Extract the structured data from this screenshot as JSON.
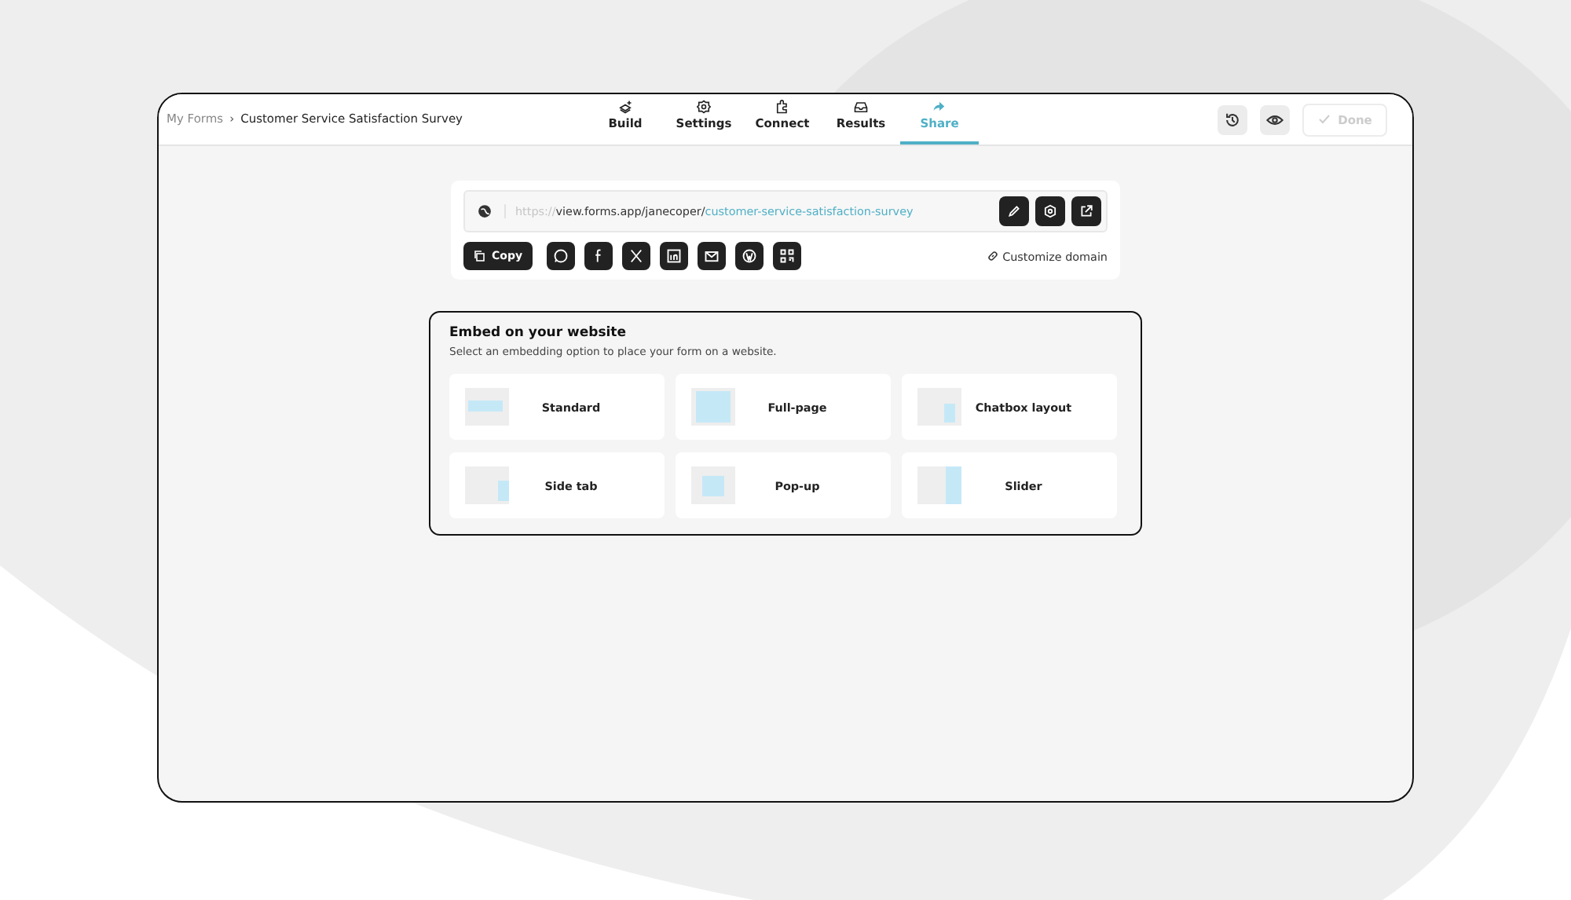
{
  "breadcrumb": {
    "parent": "My Forms",
    "separator": "›",
    "current": "Customer Service Satisfaction Survey"
  },
  "tabs": [
    {
      "label": "Build",
      "kind": "build",
      "selected": false
    },
    {
      "label": "Settings",
      "kind": "settings",
      "selected": false
    },
    {
      "label": "Connect",
      "kind": "connect",
      "selected": false
    },
    {
      "label": "Results",
      "kind": "results",
      "selected": false
    },
    {
      "label": "Share",
      "kind": "share",
      "selected": true
    }
  ],
  "done_button": {
    "label": "Done",
    "disabled": true
  },
  "share": {
    "url_scheme": "https://",
    "url_domain": "view.forms.app/janecoper/",
    "url_slug": "customer-service-satisfaction-survey",
    "copy_label": "Copy",
    "customize_label": "Customize domain"
  },
  "embed": {
    "title": "Embed on your website",
    "subtitle": "Select an embedding option to place your form on a website.",
    "options": [
      {
        "label": "Standard",
        "kind": "standard"
      },
      {
        "label": "Full-page",
        "kind": "fullpage"
      },
      {
        "label": "Chatbox layout",
        "kind": "chatbox"
      },
      {
        "label": "Side tab",
        "kind": "sidetab"
      },
      {
        "label": "Pop-up",
        "kind": "popup"
      },
      {
        "label": "Slider",
        "kind": "slider"
      }
    ]
  }
}
